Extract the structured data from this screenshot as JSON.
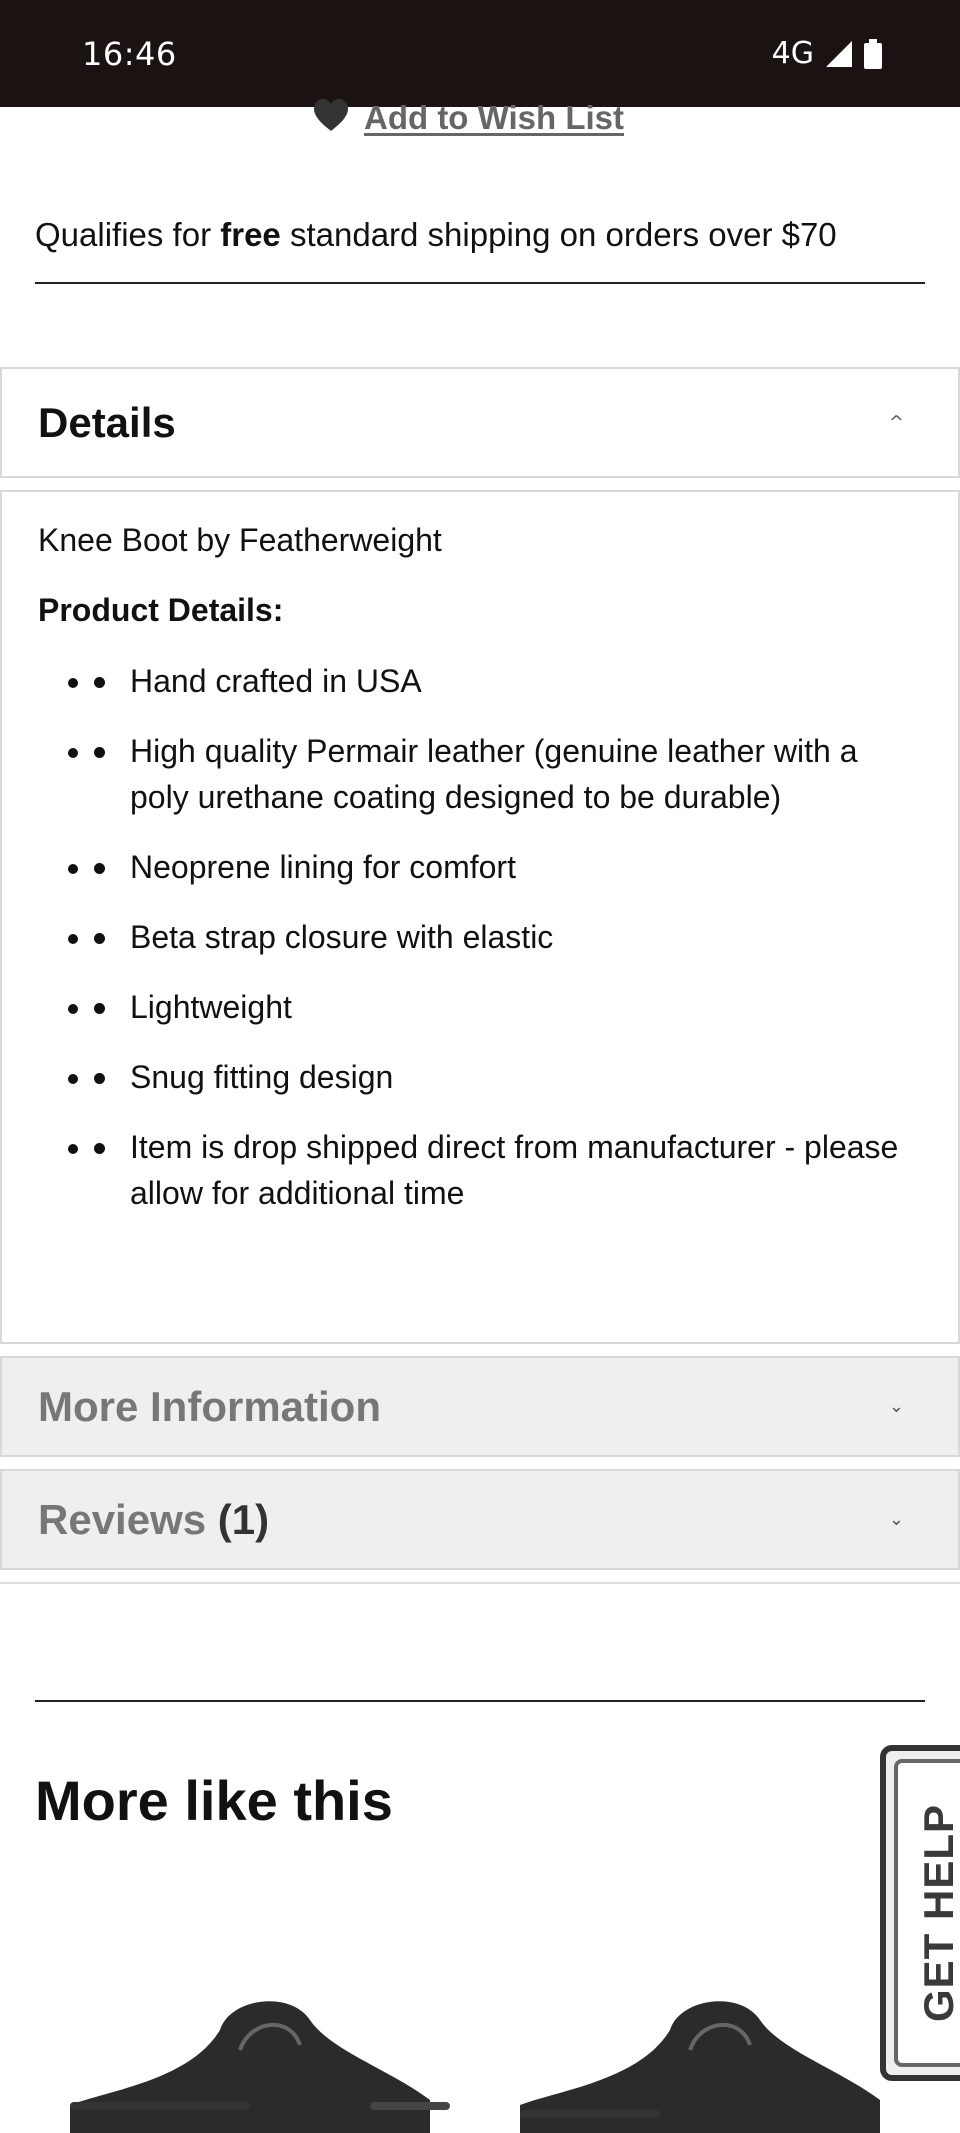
{
  "status_bar": {
    "time": "16:46",
    "network": "4G",
    "icons": [
      "signal-icon",
      "battery-icon"
    ]
  },
  "wishlist": {
    "icon": "heart-icon",
    "label": "Add to Wish List"
  },
  "shipping": {
    "prefix": "Qualifies for ",
    "emphasis": "free",
    "suffix": " standard shipping on orders over $70"
  },
  "details": {
    "title": "Details",
    "intro": "Knee Boot by Featherweight",
    "subheading": "Product Details:",
    "items": [
      "Hand crafted in USA",
      "High quality Permair leather (genuine leather with a poly urethane coating designed to be durable)",
      "Neoprene lining for comfort",
      "Beta strap closure with elastic",
      "Lightweight",
      "Snug fitting design",
      "Item is drop shipped direct from manufacturer - please allow for additional time"
    ]
  },
  "more_information": {
    "title": "More Information"
  },
  "reviews": {
    "title": "Reviews",
    "count": "(1)"
  },
  "more_like_this": {
    "title": "More like this"
  },
  "help": {
    "label": "GET HELP"
  },
  "colors": {
    "status_bar_bg": "#1b1311",
    "accordion_inactive_bg": "#efefef",
    "muted_text": "#777777"
  }
}
